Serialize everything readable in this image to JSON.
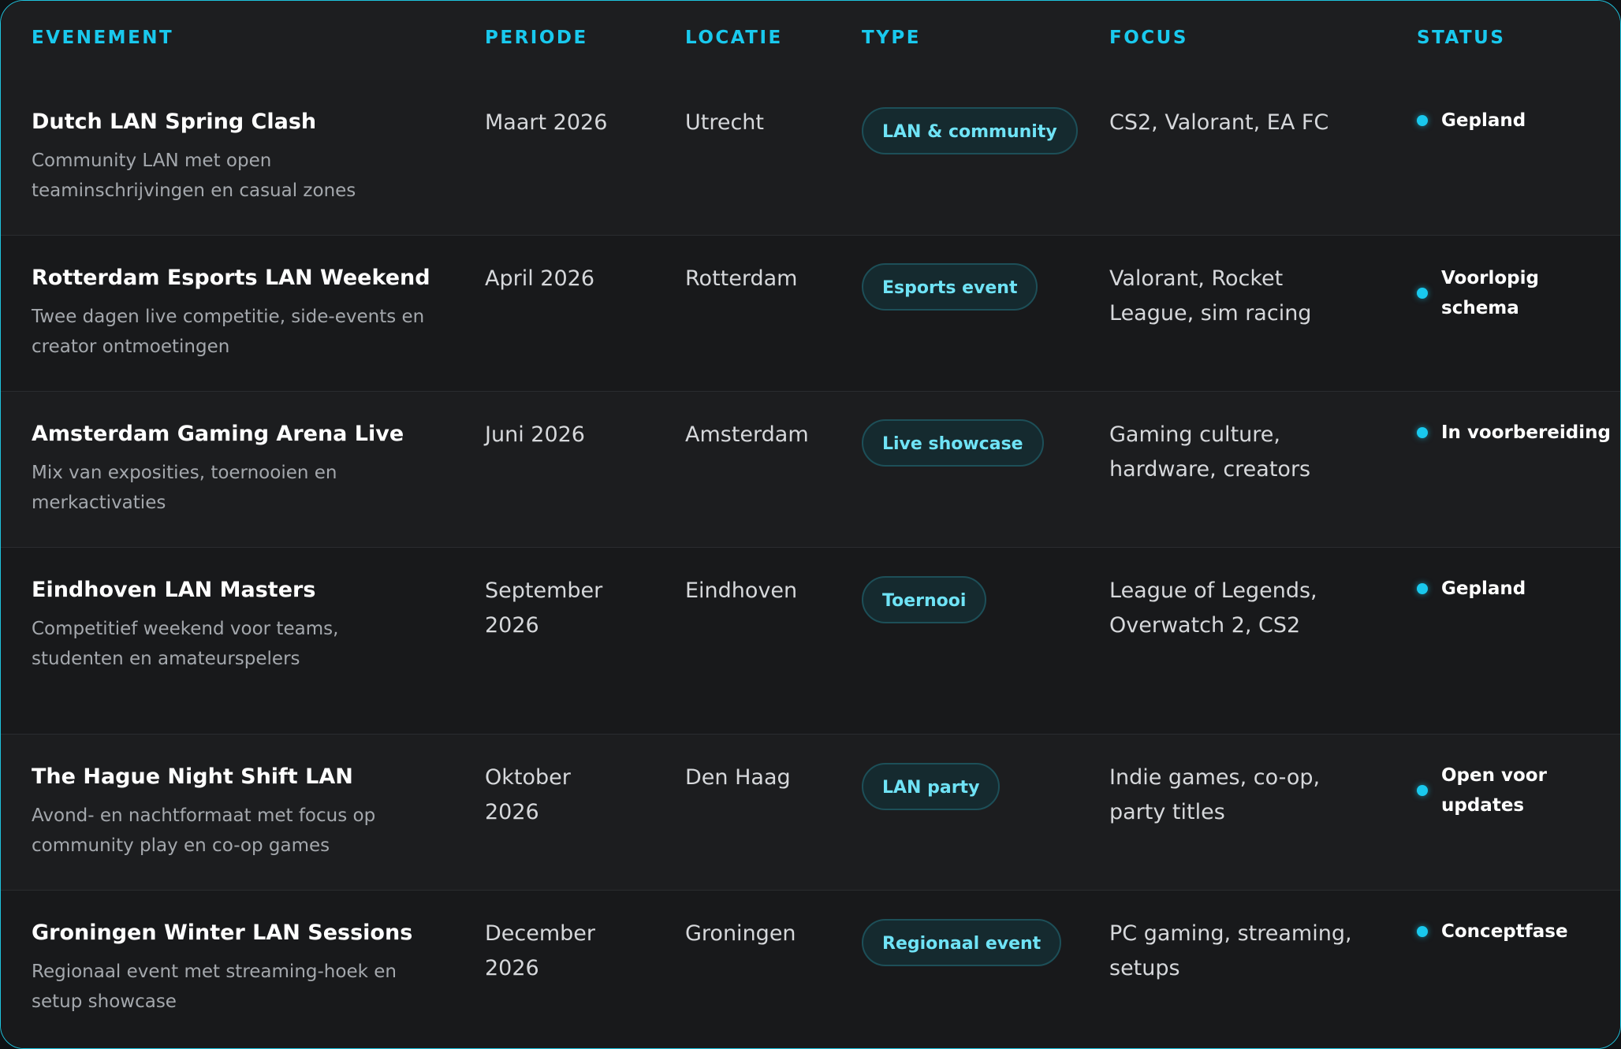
{
  "headers": {
    "event": "EVENEMENT",
    "period": "PERIODE",
    "location": "LOCATIE",
    "type": "TYPE",
    "focus": "FOCUS",
    "status": "STATUS"
  },
  "rows": [
    {
      "title": "Dutch LAN Spring Clash",
      "description": "Community LAN met open teaminschrijvingen en casual zones",
      "period": "Maart 2026",
      "location": "Utrecht",
      "type": "LAN & community",
      "focus": "CS2, Valorant, EA FC",
      "status": "Gepland"
    },
    {
      "title": "Rotterdam Esports LAN Weekend",
      "description": "Twee dagen live competitie, side-events en creator ontmoetingen",
      "period": "April 2026",
      "location": "Rotterdam",
      "type": "Esports event",
      "focus": "Valorant, Rocket League, sim racing",
      "status": "Voorlopig schema"
    },
    {
      "title": "Amsterdam Gaming Arena Live",
      "description": "Mix van exposities, toernooien en merkactivaties",
      "period": "Juni 2026",
      "location": "Amsterdam",
      "type": "Live showcase",
      "focus": "Gaming culture, hardware, creators",
      "status": "In voorbereiding"
    },
    {
      "title": "Eindhoven LAN Masters",
      "description": "Competitief weekend voor teams, studenten en amateurspelers",
      "period": "September 2026",
      "location": "Eindhoven",
      "type": "Toernooi",
      "focus": "League of Legends, Overwatch 2, CS2",
      "status": "Gepland"
    },
    {
      "title": "The Hague Night Shift LAN",
      "description": "Avond- en nachtformaat met focus op community play en co-op games",
      "period": "Oktober 2026",
      "location": "Den Haag",
      "type": "LAN party",
      "focus": "Indie games, co-op, party titles",
      "status": "Open voor updates"
    },
    {
      "title": "Groningen Winter LAN Sessions",
      "description": "Regionaal event met streaming-hoek en setup showcase",
      "period": "December 2026",
      "location": "Groningen",
      "type": "Regionaal event",
      "focus": "PC gaming, streaming, setups",
      "status": "Conceptfase"
    }
  ],
  "colors": {
    "accent": "#19c9ee",
    "border": "#1ec3dd",
    "pill_bg": "#152a2f",
    "pill_text": "#6fe3f6"
  }
}
